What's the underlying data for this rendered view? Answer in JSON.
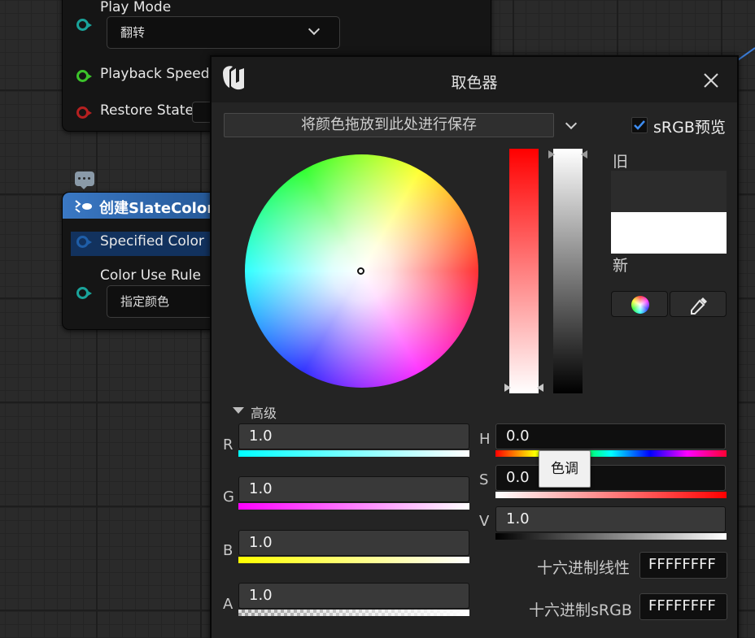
{
  "graph": {
    "node1": {
      "play_mode_label": "Play Mode",
      "play_mode_value": "翻转",
      "playback_speed_label": "Playback Speed",
      "restore_state_label": "Restore State"
    },
    "node2": {
      "title": "创建SlateColor",
      "specified_color_label": "Specified Color",
      "color_use_rule_label": "Color Use Rule",
      "color_use_rule_value": "指定颜色"
    }
  },
  "picker": {
    "title": "取色器",
    "save_drop_zone": "将颜色拖放到此处进行保存",
    "srgb_preview_label": "sRGB预览",
    "srgb_preview_checked": true,
    "old_label": "旧",
    "new_label": "新",
    "advanced_label": "高级",
    "channels": {
      "r_label": "R",
      "r_value": "1.0",
      "g_label": "G",
      "g_value": "1.0",
      "b_label": "B",
      "b_value": "1.0",
      "a_label": "A",
      "a_value": "1.0",
      "h_label": "H",
      "h_value": "0.0",
      "s_label": "S",
      "s_value": "0.0",
      "v_label": "V",
      "v_value": "1.0"
    },
    "tooltip_hue": "色调",
    "hex_linear_label": "十六进制线性",
    "hex_linear_value": "FFFFFFFF",
    "hex_srgb_label": "十六进制sRGB",
    "hex_srgb_value": "FFFFFFFF",
    "old_color": "#2c2c2c",
    "new_color": "#ffffff",
    "accent_color": "#2f6fd0"
  }
}
